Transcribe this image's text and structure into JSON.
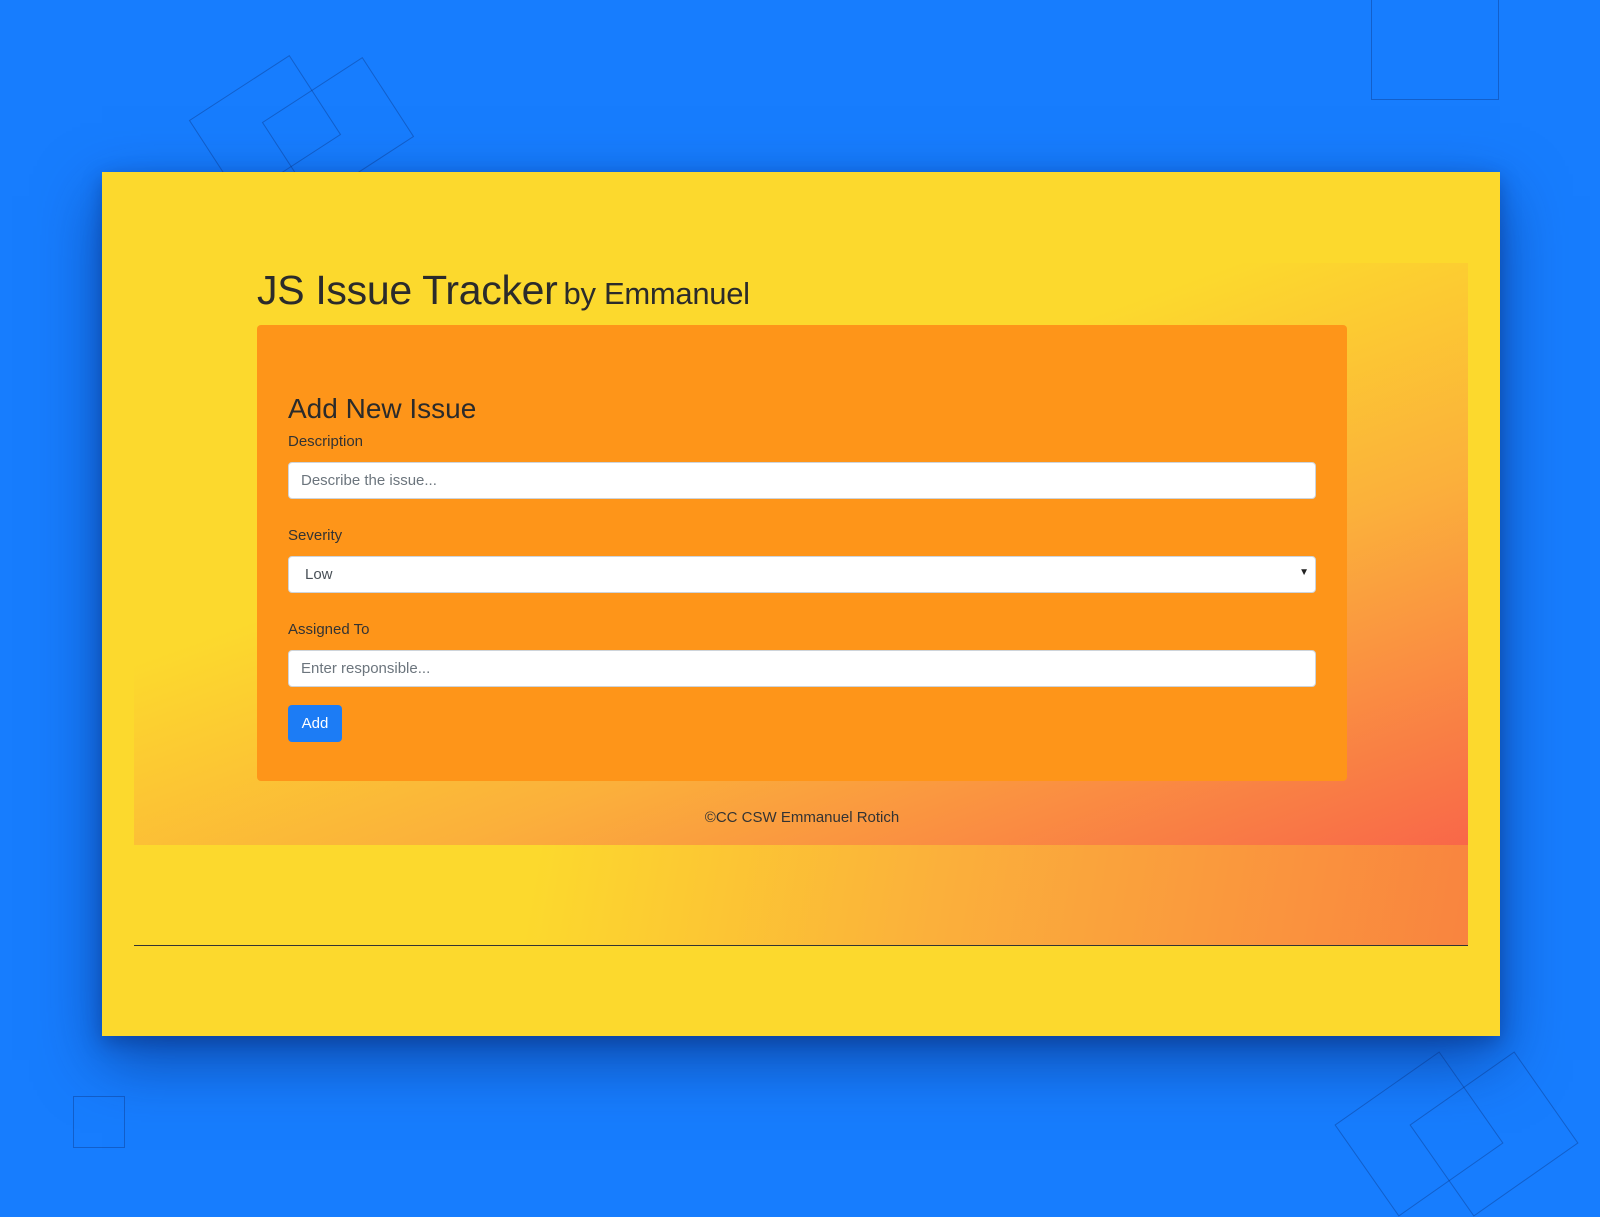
{
  "header": {
    "title": "JS Issue Tracker",
    "byline": "by Emmanuel"
  },
  "form": {
    "heading": "Add New Issue",
    "description": {
      "label": "Description",
      "placeholder": "Describe the issue..."
    },
    "severity": {
      "label": "Severity",
      "selected": "Low"
    },
    "assigned_to": {
      "label": "Assigned To",
      "placeholder": "Enter responsible..."
    },
    "submit_label": "Add"
  },
  "footer": {
    "credit": "©CC CSW Emmanuel Rotich"
  },
  "colors": {
    "page_background": "#177dfe",
    "window_background": "#fcd92d",
    "card_background": "#fe9519",
    "button_background": "#1c7cf5",
    "gradient_end": "#f8464f"
  },
  "icons": {
    "select_arrow": "caret-down-icon"
  }
}
